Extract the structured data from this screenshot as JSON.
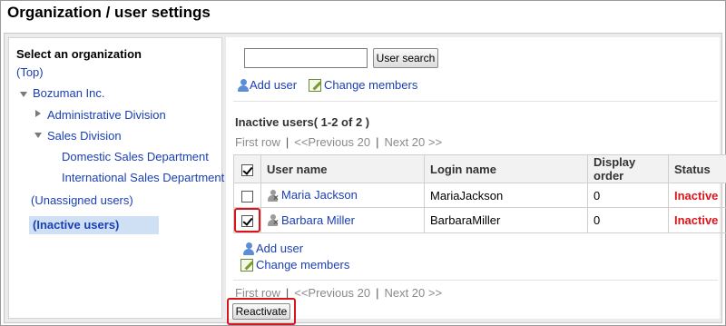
{
  "page": {
    "title": "Organization / user settings"
  },
  "tree": {
    "title": "Select an organization",
    "top": "(Top)",
    "org": "Bozuman Inc.",
    "admin_division": "Administrative Division",
    "sales_division": "Sales Division",
    "domestic": "Domestic Sales Department",
    "international": "International Sales Department",
    "unassigned": "(Unassigned users)",
    "inactive": "(Inactive users)"
  },
  "search": {
    "value": "",
    "placeholder": "",
    "button": "User search"
  },
  "actions": {
    "add_user": "Add user",
    "change_members": "Change members"
  },
  "list": {
    "title": "Inactive users( 1-2 of 2 )",
    "pager": {
      "first": "First row",
      "prev": "<<Previous 20",
      "next": "Next 20 >>",
      "sep": "|"
    },
    "columns": [
      "User name",
      "Login name",
      "Display order",
      "Status"
    ],
    "rows": [
      {
        "name": "Maria Jackson",
        "login": "MariaJackson",
        "order": "0",
        "status": "Inactive",
        "checked": false
      },
      {
        "name": "Barbara Miller",
        "login": "BarbaraMiller",
        "order": "0",
        "status": "Inactive",
        "checked": true
      }
    ]
  },
  "footer": {
    "reactivate": "Reactivate"
  },
  "colors": {
    "link": "#1a3fb5",
    "inactive": "#e0141b",
    "highlight": "#d9141b",
    "selected_bg": "#cfe0f5"
  }
}
